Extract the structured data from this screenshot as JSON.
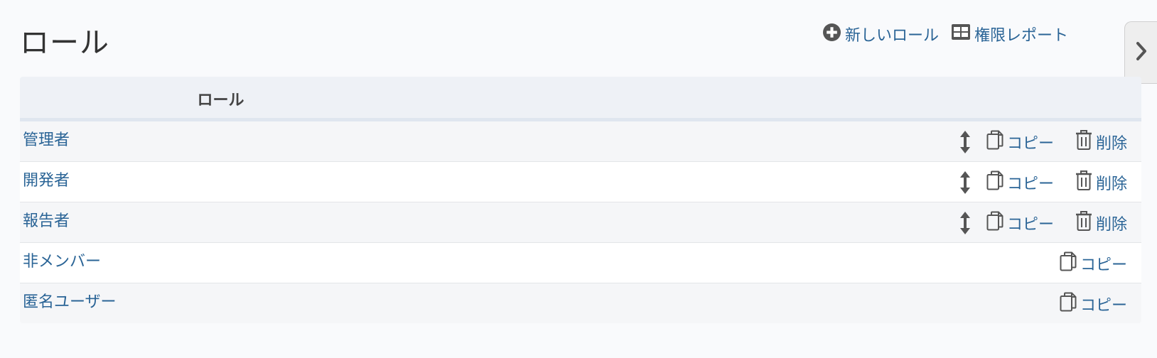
{
  "page": {
    "title": "ロール"
  },
  "toolbar": {
    "new_role_label": "新しいロール",
    "permissions_report_label": "権限レポート"
  },
  "table": {
    "header_role": "ロール",
    "copy_label": "コピー",
    "delete_label": "削除",
    "rows": [
      {
        "name": "管理者",
        "sortable": true,
        "deletable": true
      },
      {
        "name": "開発者",
        "sortable": true,
        "deletable": true
      },
      {
        "name": "報告者",
        "sortable": true,
        "deletable": true
      },
      {
        "name": "非メンバー",
        "sortable": false,
        "deletable": false
      },
      {
        "name": "匿名ユーザー",
        "sortable": false,
        "deletable": false
      }
    ]
  },
  "icons": {
    "new_role": "plus-circle-icon",
    "report": "table-grid-icon",
    "sort": "vertical-arrows-icon",
    "copy": "copy-icon",
    "delete": "trash-icon",
    "sidebar": "chevron-right-icon"
  },
  "colors": {
    "link": "#2a6496",
    "icon": "#555555",
    "header_bg": "#eef1f6",
    "row_alt_bg": "#f5f6f8"
  }
}
